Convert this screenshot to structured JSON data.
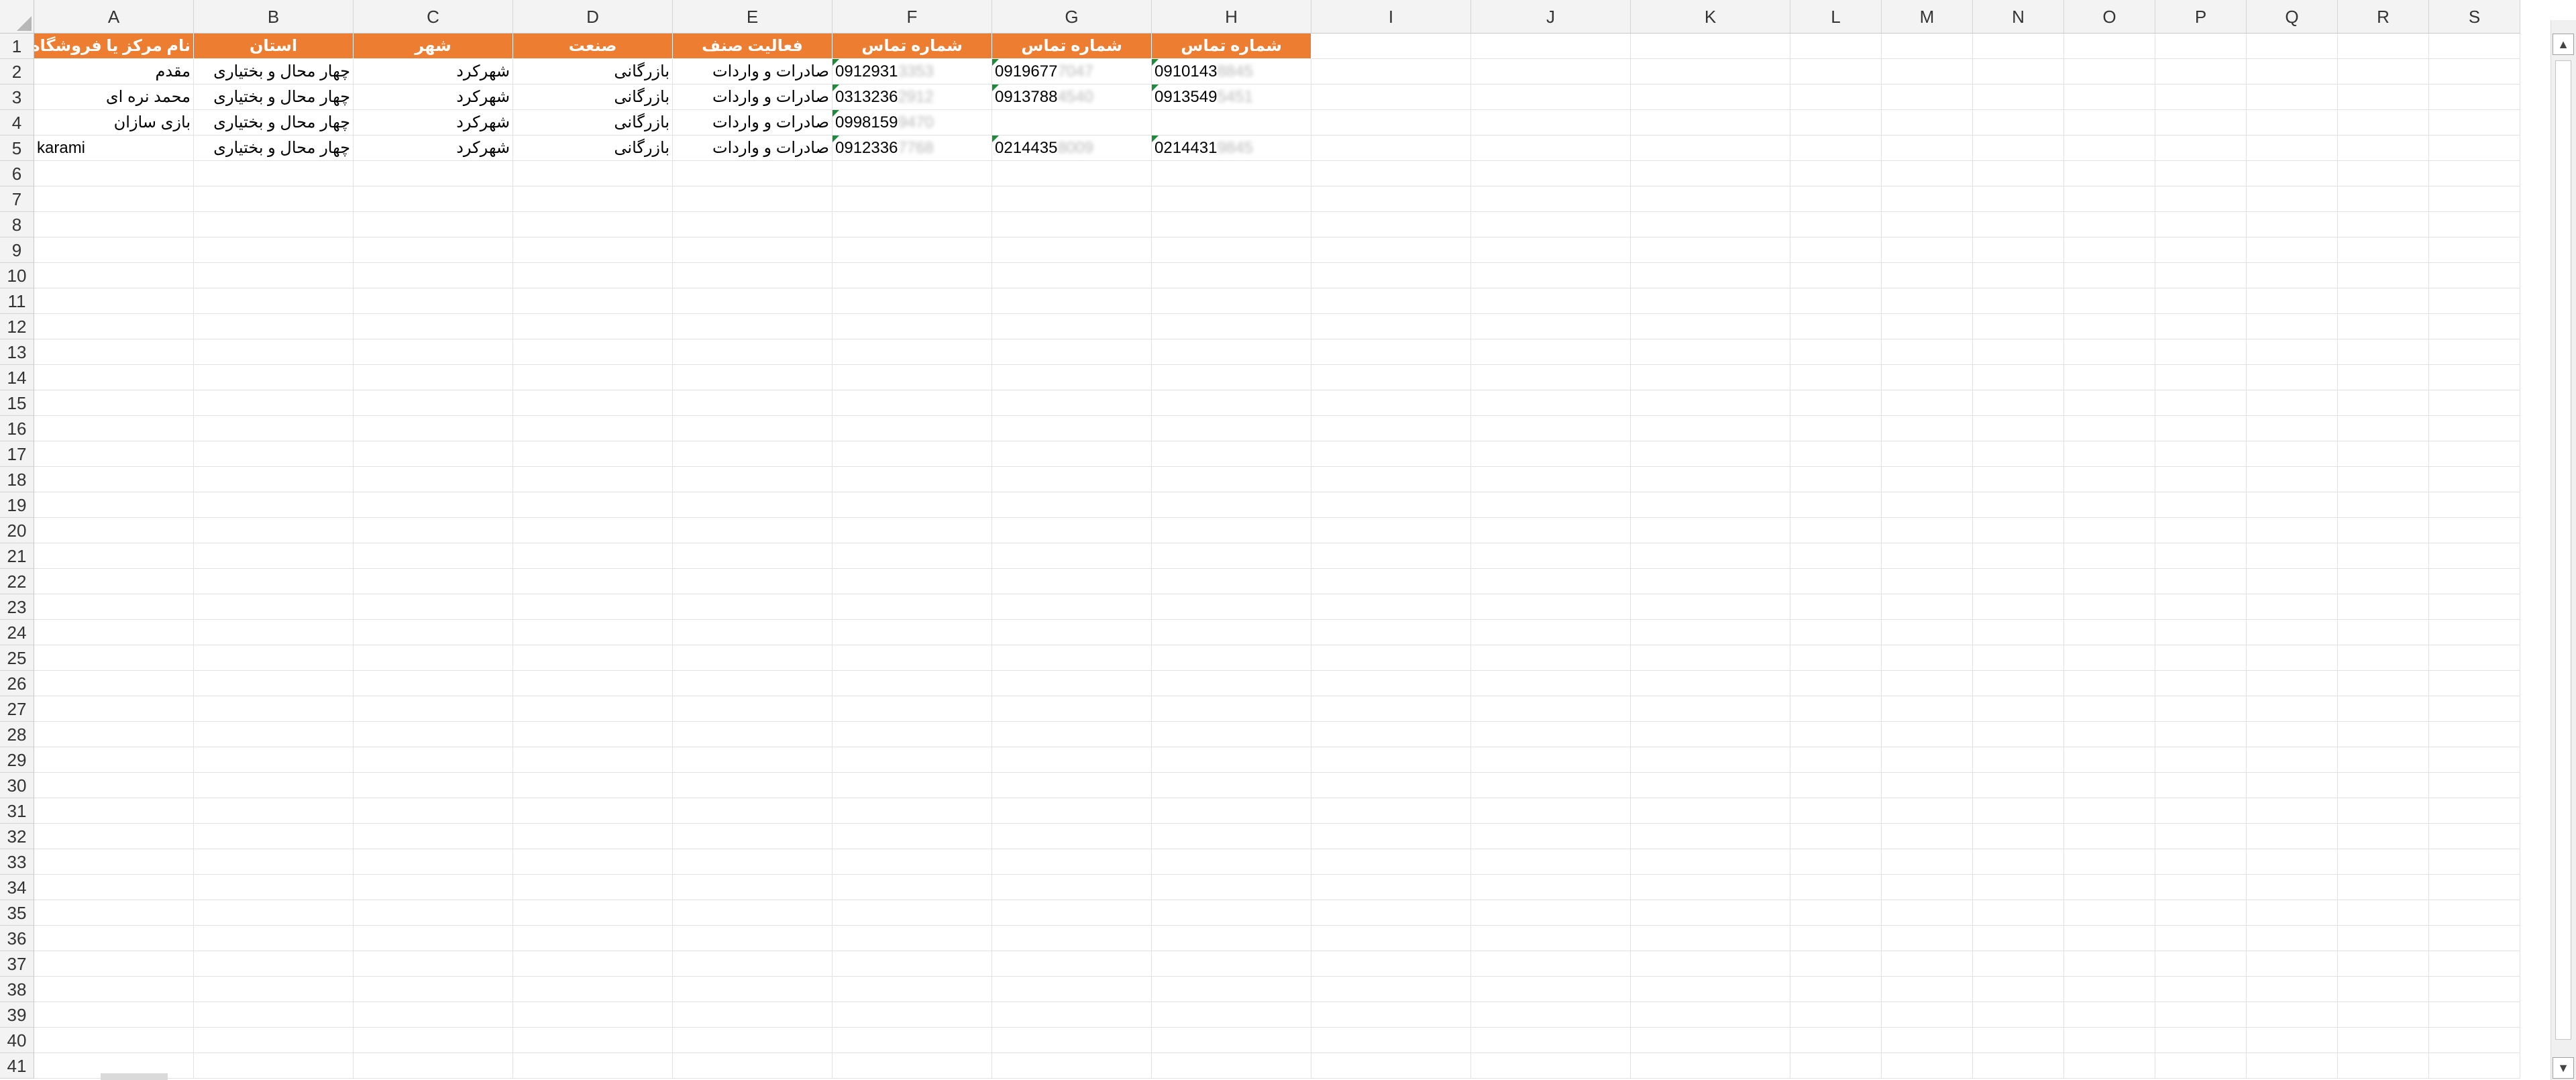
{
  "columns": [
    "A",
    "B",
    "C",
    "D",
    "E",
    "F",
    "G",
    "H",
    "I",
    "J",
    "K",
    "L",
    "M",
    "N",
    "O",
    "P",
    "Q",
    "R",
    "S"
  ],
  "rows": [
    "1",
    "2",
    "3",
    "4",
    "5",
    "6",
    "7",
    "8",
    "9",
    "10",
    "11",
    "12",
    "13",
    "14",
    "15",
    "16",
    "17",
    "18",
    "19",
    "20",
    "21",
    "22",
    "23",
    "24",
    "25",
    "26",
    "27",
    "28",
    "29",
    "30",
    "31",
    "32",
    "33",
    "34",
    "35",
    "36",
    "37",
    "38",
    "39",
    "40",
    "41"
  ],
  "header_fill": "#ed7d31",
  "headers": [
    "نام مرکز یا فروشگاه",
    "استان",
    "شهر",
    "صنعت",
    "فعالیت صنف",
    "شماره تماس",
    "شماره تماس",
    "شماره تماس"
  ],
  "records": [
    {
      "name": "مقدم",
      "province": "چهار محال و بختیاری",
      "city": "شهرکرد",
      "industry": "بازرگانی",
      "activity": "صادرات و واردات",
      "phones": [
        {
          "visible": "0912931",
          "blurred": "3353"
        },
        {
          "visible": "0919677",
          "blurred": "7047"
        },
        {
          "visible": "0910143",
          "blurred": "8845"
        }
      ]
    },
    {
      "name": "محمد نره ای",
      "province": "چهار محال و بختیاری",
      "city": "شهرکرد",
      "industry": "بازرگانی",
      "activity": "صادرات و واردات",
      "phones": [
        {
          "visible": "0313236",
          "blurred": "2912"
        },
        {
          "visible": "0913788",
          "blurred": "4540"
        },
        {
          "visible": "0913549",
          "blurred": "5451"
        }
      ]
    },
    {
      "name": "بازی سازان",
      "province": "چهار محال و بختیاری",
      "city": "شهرکرد",
      "industry": "بازرگانی",
      "activity": "صادرات و واردات",
      "phones": [
        {
          "visible": "0998159",
          "blurred": "9470"
        }
      ]
    },
    {
      "name": "karami",
      "province": "چهار محال و بختیاری",
      "city": "شهرکرد",
      "industry": "بازرگانی",
      "activity": "صادرات و واردات",
      "phones": [
        {
          "visible": "0912336",
          "blurred": "7768"
        },
        {
          "visible": "0214435",
          "blurred": "8009"
        },
        {
          "visible": "0214431",
          "blurred": "9845"
        }
      ]
    }
  ]
}
